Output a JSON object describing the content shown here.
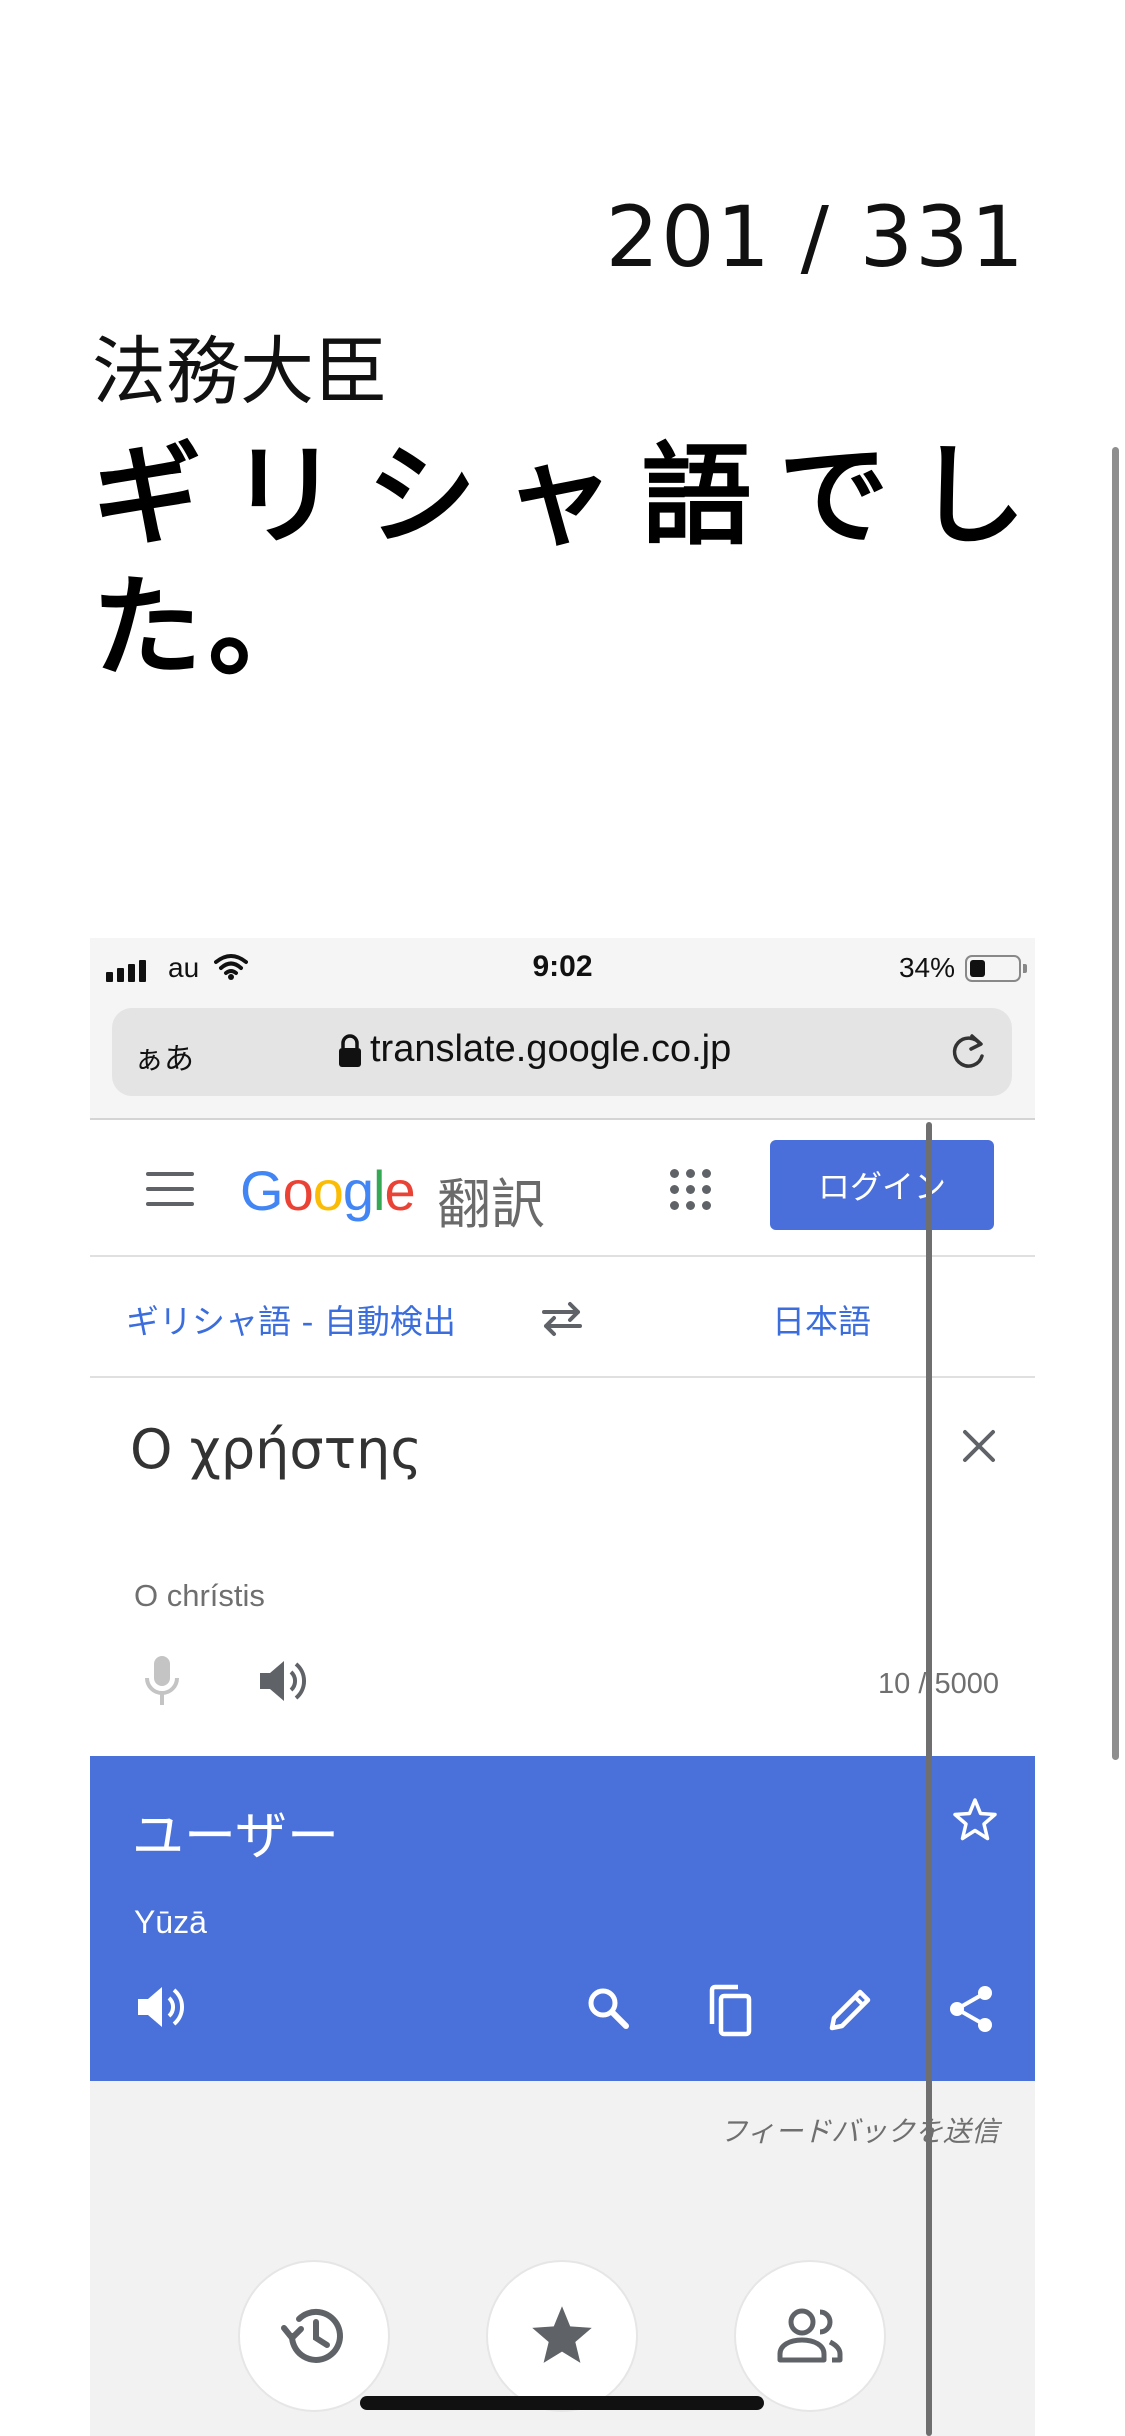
{
  "page": {
    "counter": "201 / 331",
    "subtitle": "法務大臣",
    "headline": "ギリシャ語でした。"
  },
  "status_bar": {
    "carrier": "au",
    "time": "9:02",
    "battery_percent": "34%",
    "battery_level": 0.34
  },
  "browser": {
    "text_size_label": "ぁあ",
    "url": "translate.google.co.jp"
  },
  "translate_app": {
    "logo_text": "Google",
    "logo_suffix": "翻訳",
    "login_label": "ログイン",
    "source_language": "ギリシャ語 - 自動検出",
    "target_language": "日本語",
    "source_text": "Ο χρήστης",
    "source_transliteration": "O chrístis",
    "char_count": "10 / 5000",
    "translation": "ユーザー",
    "translation_transliteration": "Yūzā",
    "feedback_label": "フィードバックを送信",
    "brand_blue": "#4a70da"
  },
  "icons": [
    "menu-icon",
    "apps-icon",
    "swap-icon",
    "close-icon",
    "mic-icon",
    "speaker-icon",
    "star-icon",
    "search-icon",
    "copy-icon",
    "edit-icon",
    "share-icon",
    "history-icon",
    "saved-star-icon",
    "community-icon"
  ]
}
